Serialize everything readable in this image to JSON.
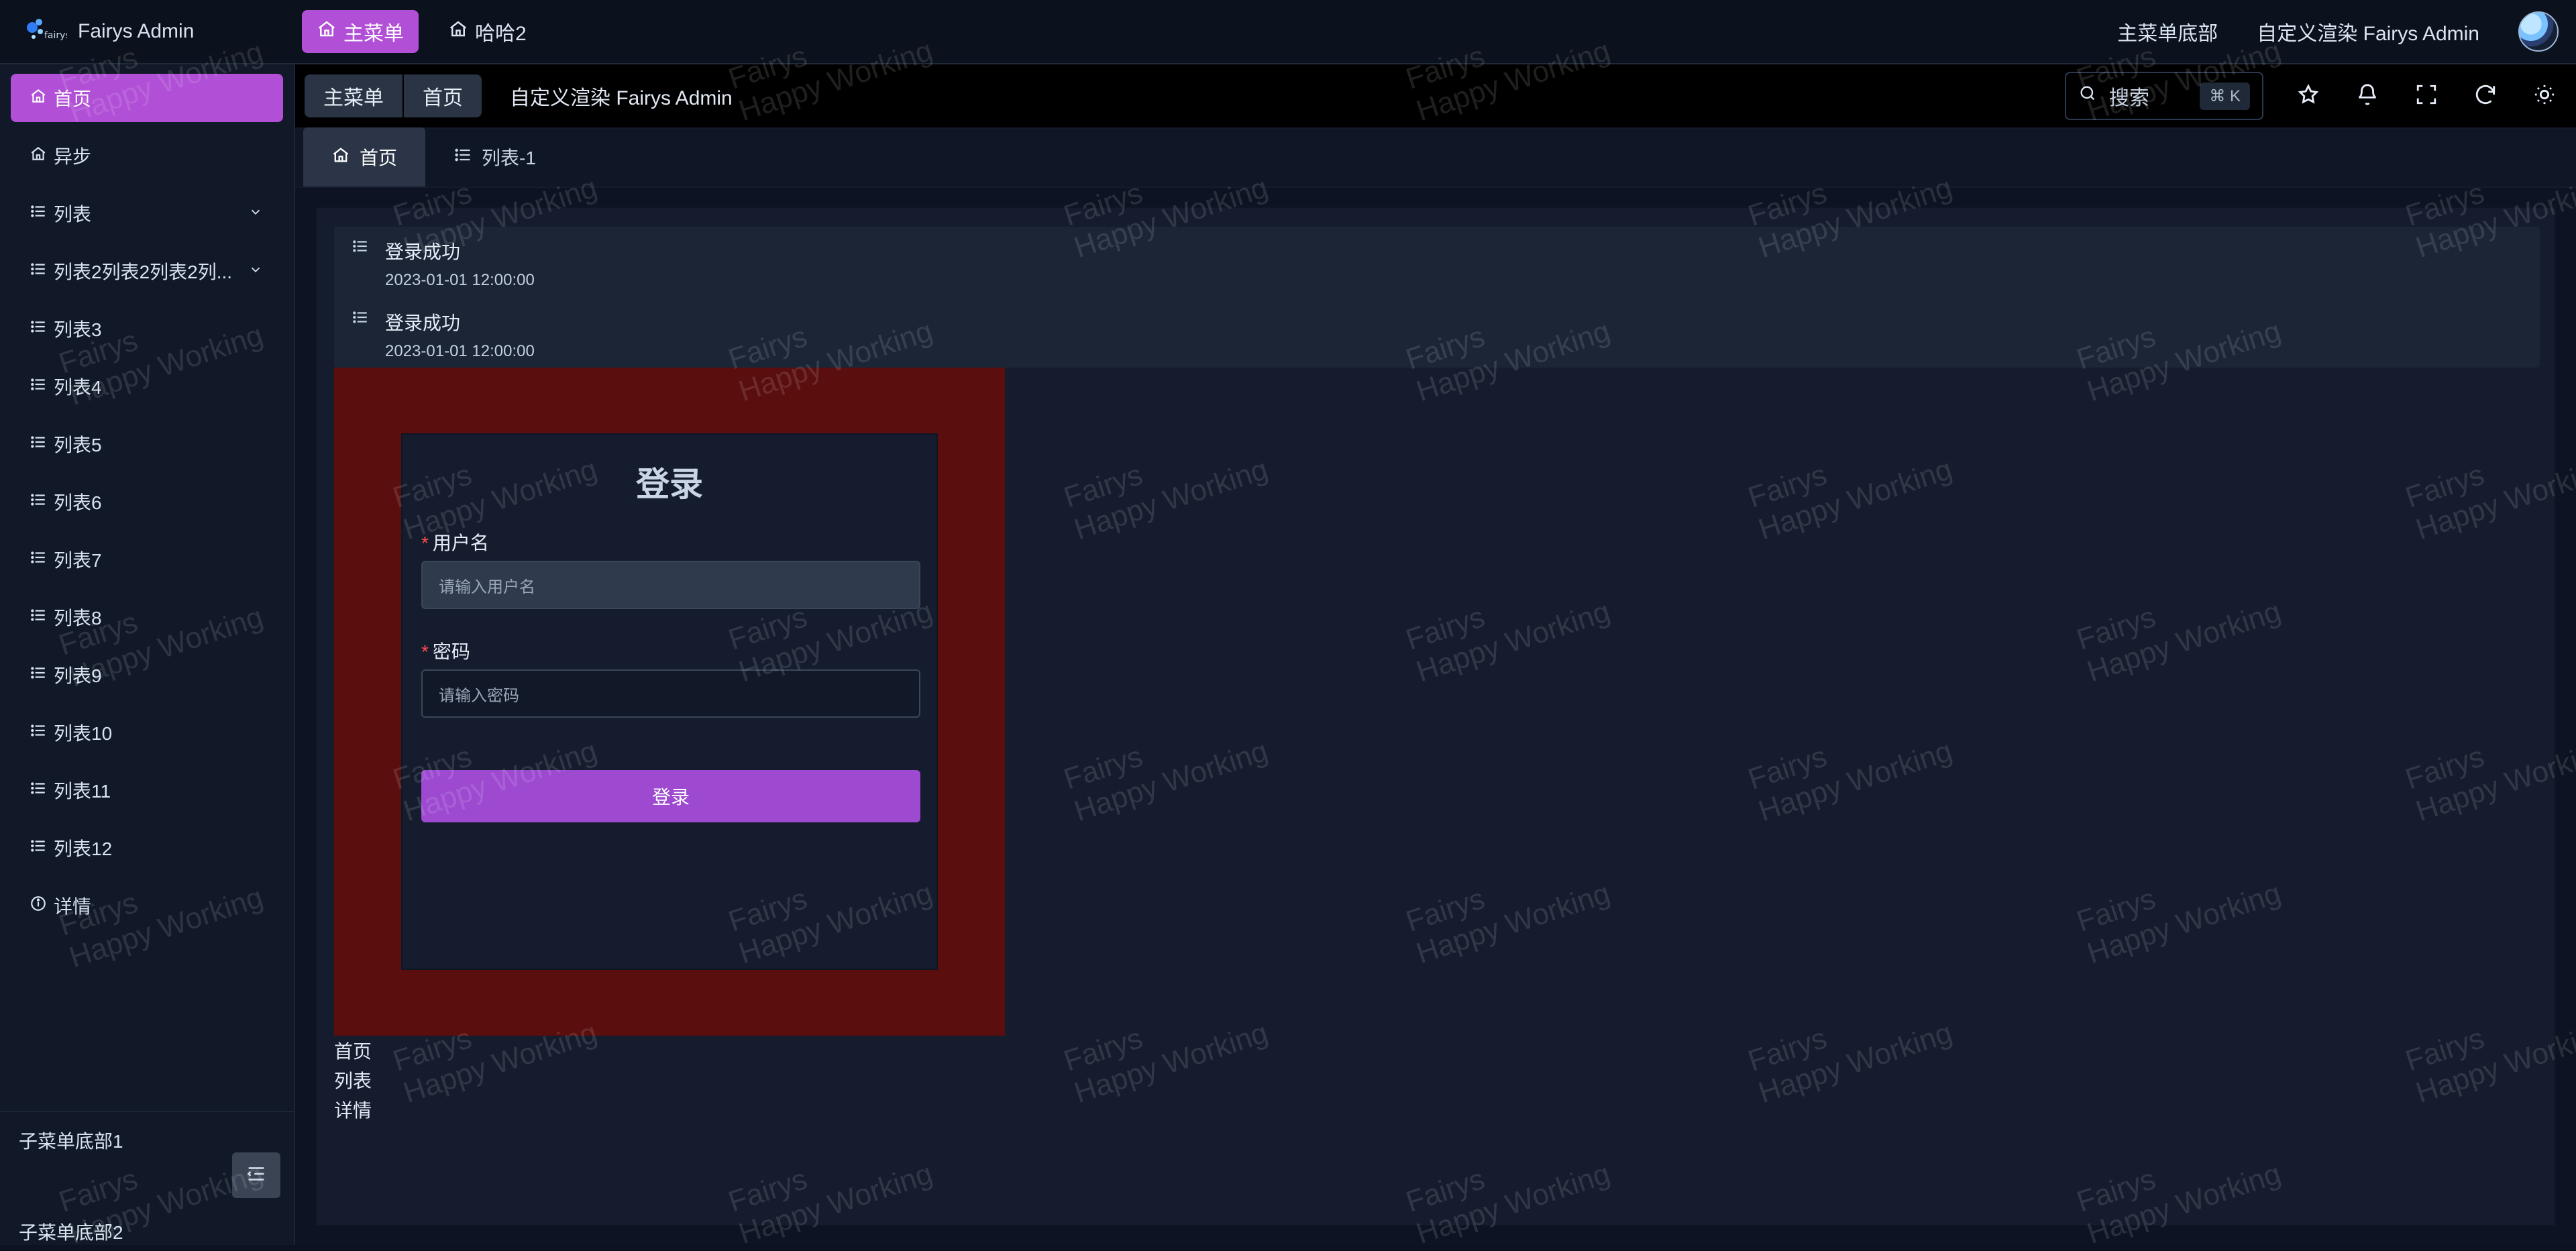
{
  "colors": {
    "accent": "#b14fd6",
    "accent_alt": "#9d4ad1",
    "login_bg": "#5a0e0e",
    "danger": "#ff4d4f"
  },
  "app": {
    "title": "Fairys Admin",
    "logo_icon": "fairys-logo-icon"
  },
  "top_nav": {
    "items": [
      {
        "label": "主菜单",
        "icon": "home-icon",
        "active": true
      },
      {
        "label": "哈哈2",
        "icon": "home-icon",
        "active": false
      }
    ],
    "right": {
      "menu_bottom": "主菜单底部",
      "custom_render": "自定义渲染 Fairys Admin"
    }
  },
  "sidebar": {
    "items": [
      {
        "label": "首页",
        "icon": "home-icon",
        "active": true,
        "expand": false
      },
      {
        "label": "异步",
        "icon": "home-icon",
        "active": false,
        "expand": false
      },
      {
        "label": "列表",
        "icon": "list-icon",
        "active": false,
        "expand": true
      },
      {
        "label": "列表2列表2列表2列...",
        "icon": "list-icon",
        "active": false,
        "expand": true
      },
      {
        "label": "列表3",
        "icon": "list-icon",
        "active": false,
        "expand": false
      },
      {
        "label": "列表4",
        "icon": "list-icon",
        "active": false,
        "expand": false
      },
      {
        "label": "列表5",
        "icon": "list-icon",
        "active": false,
        "expand": false
      },
      {
        "label": "列表6",
        "icon": "list-icon",
        "active": false,
        "expand": false
      },
      {
        "label": "列表7",
        "icon": "list-icon",
        "active": false,
        "expand": false
      },
      {
        "label": "列表8",
        "icon": "list-icon",
        "active": false,
        "expand": false
      },
      {
        "label": "列表9",
        "icon": "list-icon",
        "active": false,
        "expand": false
      },
      {
        "label": "列表10",
        "icon": "list-icon",
        "active": false,
        "expand": false
      },
      {
        "label": "列表11",
        "icon": "list-icon",
        "active": false,
        "expand": false
      },
      {
        "label": "列表12",
        "icon": "list-icon",
        "active": false,
        "expand": false
      },
      {
        "label": "详情",
        "icon": "info-icon",
        "active": false,
        "expand": false
      }
    ],
    "bottom": {
      "item1": "子菜单底部1",
      "item2": "子菜单底部2",
      "collapse_icon": "menu-collapse-icon"
    }
  },
  "header": {
    "breadcrumb": [
      "主菜单",
      "首页"
    ],
    "title": "自定义渲染 Fairys Admin",
    "search": {
      "label": "搜索",
      "shortcut": "⌘ K"
    },
    "icons": [
      "star-icon",
      "bell-icon",
      "fullscreen-icon",
      "refresh-icon",
      "sun-icon"
    ]
  },
  "tabs": [
    {
      "label": "首页",
      "icon": "home-icon",
      "active": true
    },
    {
      "label": "列表-1",
      "icon": "list-icon",
      "active": false
    }
  ],
  "content": {
    "list": [
      {
        "title": "登录成功",
        "time": "2023-01-01 12:00:00"
      },
      {
        "title": "登录成功",
        "time": "2023-01-01 12:00:00"
      }
    ],
    "login": {
      "title": "登录",
      "username_label": "用户名",
      "username_placeholder": "请输入用户名",
      "password_label": "密码",
      "password_placeholder": "请输入密码",
      "submit": "登录"
    },
    "links": [
      "首页",
      "列表",
      "详情"
    ]
  },
  "watermark": {
    "line1": "Fairys",
    "line2": "Happy Working"
  }
}
